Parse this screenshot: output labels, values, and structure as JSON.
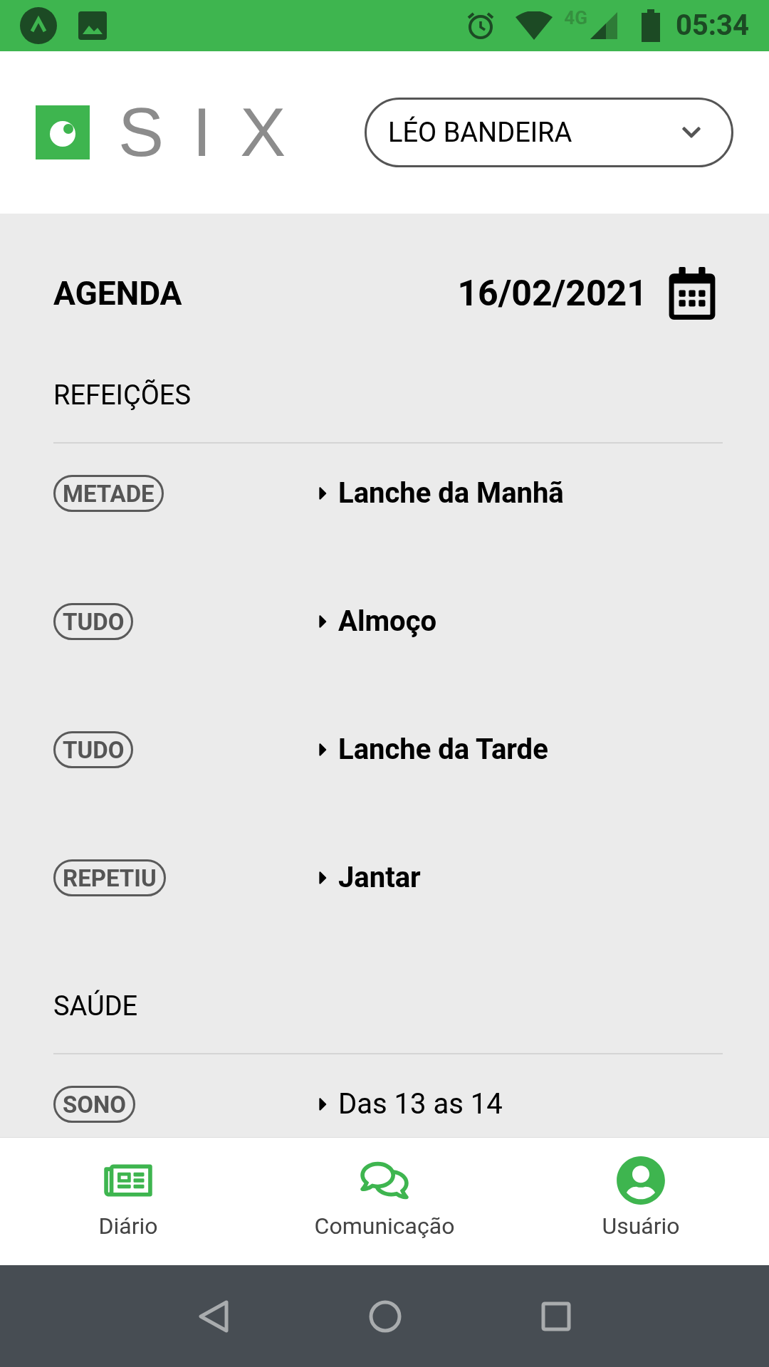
{
  "status_bar": {
    "network": "4G",
    "time": "05:34"
  },
  "header": {
    "logo": "SIX",
    "user_select": {
      "value": "LÉO BANDEIRA"
    }
  },
  "agenda": {
    "title": "AGENDA",
    "date": "16/02/2021",
    "sections": [
      {
        "heading": "REFEIÇÕES",
        "items": [
          {
            "kind": "meal",
            "badge": "METADE",
            "label": "Lanche da Manhã"
          },
          {
            "kind": "meal",
            "badge": "TUDO",
            "label": "Almoço"
          },
          {
            "kind": "meal",
            "badge": "TUDO",
            "label": "Lanche da Tarde"
          },
          {
            "kind": "meal",
            "badge": "REPETIU",
            "label": "Jantar"
          }
        ]
      },
      {
        "heading": "SAÚDE",
        "items": [
          {
            "kind": "time",
            "badge": "SONO",
            "label": "Das 13 as 14"
          }
        ]
      }
    ]
  },
  "bottom_nav": [
    {
      "kind": "diary",
      "label": "Diário"
    },
    {
      "kind": "chat",
      "label": "Comunicação"
    },
    {
      "kind": "user",
      "label": "Usuário"
    }
  ]
}
